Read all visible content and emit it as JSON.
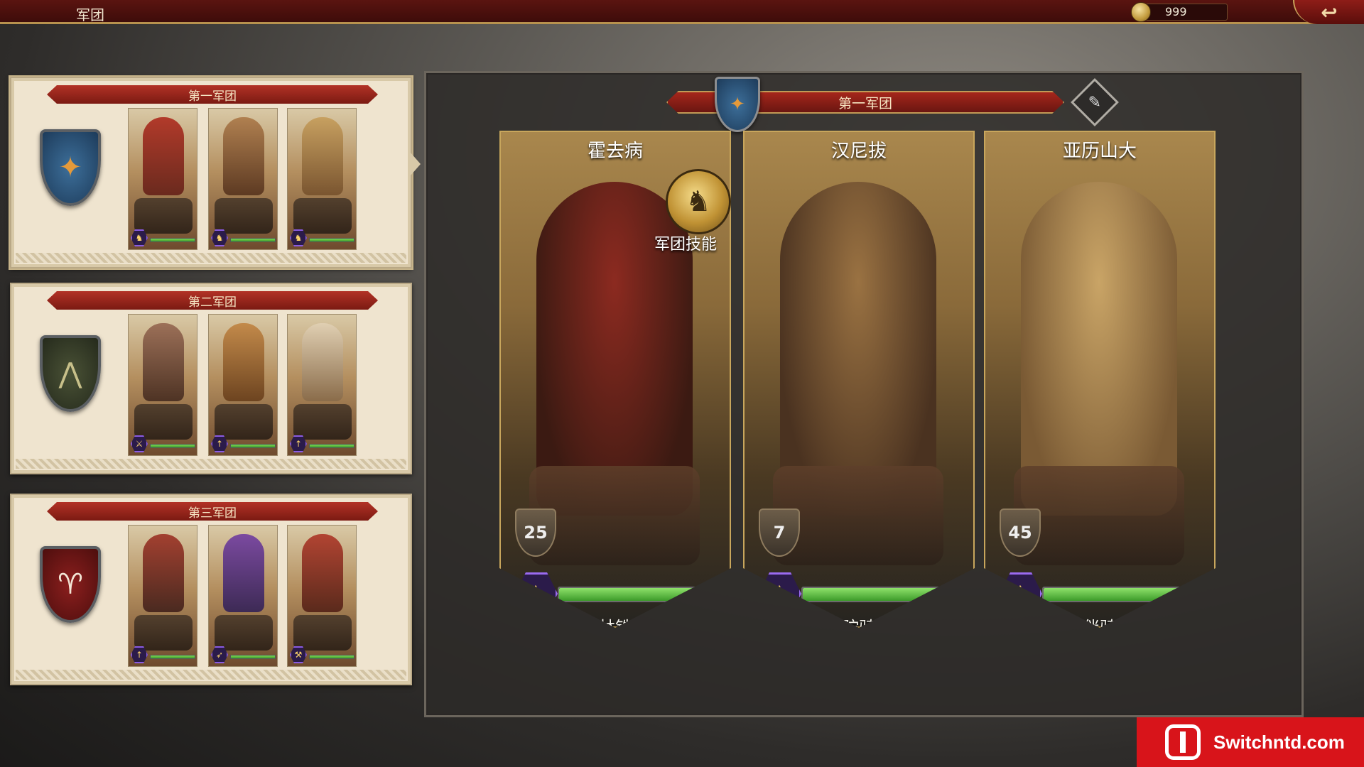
{
  "topbar": {
    "title": "军团",
    "coins": "999",
    "back_icon": "↩"
  },
  "legions": [
    {
      "name": "第一军团",
      "emblem_color": "blue",
      "emblem_icon": "bird-emblem-icon",
      "heroes": [
        {
          "unit_icon": "horse-head-icon",
          "hp": 100,
          "colors": [
            "#b23a2a",
            "#6a2a1e"
          ]
        },
        {
          "unit_icon": "horse-head-icon",
          "hp": 100,
          "colors": [
            "#b08050",
            "#5d3a22"
          ]
        },
        {
          "unit_icon": "horse-head-icon",
          "hp": 100,
          "colors": [
            "#c7a060",
            "#7a5530"
          ]
        }
      ]
    },
    {
      "name": "第二军团",
      "emblem_color": "green",
      "emblem_icon": "arrow-emblem-icon",
      "heroes": [
        {
          "unit_icon": "sword-icon",
          "hp": 100,
          "colors": [
            "#9c7058",
            "#4e3324"
          ]
        },
        {
          "unit_icon": "spear-icon",
          "hp": 100,
          "colors": [
            "#c38a4a",
            "#6d4420"
          ]
        },
        {
          "unit_icon": "spear-icon",
          "hp": 100,
          "colors": [
            "#e0cfb2",
            "#8a6c4a"
          ]
        }
      ]
    },
    {
      "name": "第三军团",
      "emblem_color": "red",
      "emblem_icon": "ram-emblem-icon",
      "heroes": [
        {
          "unit_icon": "spear-icon",
          "hp": 100,
          "colors": [
            "#a34030",
            "#4a2a20"
          ]
        },
        {
          "unit_icon": "bow-icon",
          "hp": 100,
          "colors": [
            "#7b4aa0",
            "#3d2a55"
          ]
        },
        {
          "unit_icon": "axe-icon",
          "hp": 100,
          "colors": [
            "#b24432",
            "#5a2a1c"
          ]
        }
      ]
    }
  ],
  "main": {
    "legion_name": "第一军团",
    "skill_label": "军团技能",
    "generals": [
      {
        "name": "霍去病",
        "level": "25",
        "unit_name": "羽林铁骑",
        "hp": 92,
        "colors": [
          "#8c2a20",
          "#3b1a12"
        ]
      },
      {
        "name": "汉尼拔",
        "level": "7",
        "unit_name": "骆驼骑士",
        "hp": 92,
        "colors": [
          "#9a7242",
          "#4a3220"
        ]
      },
      {
        "name": "亚历山大",
        "level": "45",
        "unit_name": "伙伴骑兵",
        "hp": 92,
        "colors": [
          "#c9a466",
          "#7a5a34"
        ]
      }
    ]
  },
  "watermark": "Switchntd.com"
}
